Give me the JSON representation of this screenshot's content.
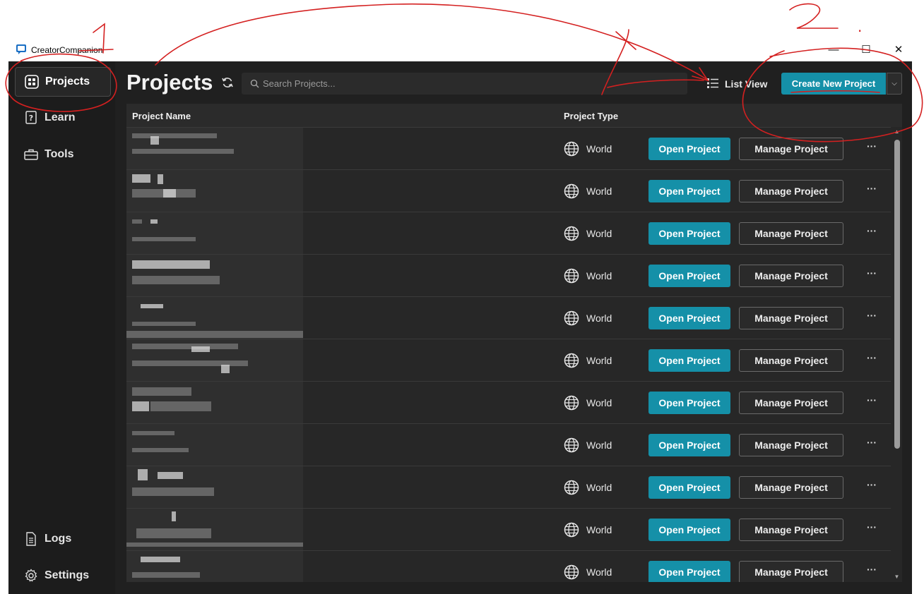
{
  "window": {
    "title": "CreatorCompanion",
    "controls": {
      "minimize": "—",
      "maximize": "☐",
      "close": "✕"
    }
  },
  "sidebar": {
    "items": [
      {
        "label": "Projects",
        "icon": "grid-icon",
        "active": true
      },
      {
        "label": "Learn",
        "icon": "help-book-icon",
        "active": false
      },
      {
        "label": "Tools",
        "icon": "toolbox-icon",
        "active": false
      }
    ],
    "bottom_items": [
      {
        "label": "Logs",
        "icon": "document-icon"
      },
      {
        "label": "Settings",
        "icon": "gear-icon"
      }
    ]
  },
  "header": {
    "title": "Projects",
    "search_placeholder": "Search Projects...",
    "view_toggle_label": "List View",
    "create_button_label": "Create New Project"
  },
  "table": {
    "columns": [
      "Project Name",
      "Project Type"
    ],
    "rows": [
      {
        "type": "World",
        "open_label": "Open Project",
        "manage_label": "Manage Project",
        "more_label": "···"
      },
      {
        "type": "World",
        "open_label": "Open Project",
        "manage_label": "Manage Project",
        "more_label": "···"
      },
      {
        "type": "World",
        "open_label": "Open Project",
        "manage_label": "Manage Project",
        "more_label": "···"
      },
      {
        "type": "World",
        "open_label": "Open Project",
        "manage_label": "Manage Project",
        "more_label": "···"
      },
      {
        "type": "World",
        "open_label": "Open Project",
        "manage_label": "Manage Project",
        "more_label": "···"
      },
      {
        "type": "World",
        "open_label": "Open Project",
        "manage_label": "Manage Project",
        "more_label": "···"
      },
      {
        "type": "World",
        "open_label": "Open Project",
        "manage_label": "Manage Project",
        "more_label": "···"
      },
      {
        "type": "World",
        "open_label": "Open Project",
        "manage_label": "Manage Project",
        "more_label": "···"
      },
      {
        "type": "World",
        "open_label": "Open Project",
        "manage_label": "Manage Project",
        "more_label": "···"
      },
      {
        "type": "World",
        "open_label": "Open Project",
        "manage_label": "Manage Project",
        "more_label": "···"
      },
      {
        "type": "World",
        "open_label": "Open Project",
        "manage_label": "Manage Project",
        "more_label": "···"
      }
    ]
  },
  "annotations": {
    "label_1": "1",
    "label_2": "2",
    "label_dot": "."
  },
  "colors": {
    "accent": "#1590a8",
    "background": "#202020",
    "sidebar": "#1c1c1c",
    "annotation": "#d42020"
  }
}
